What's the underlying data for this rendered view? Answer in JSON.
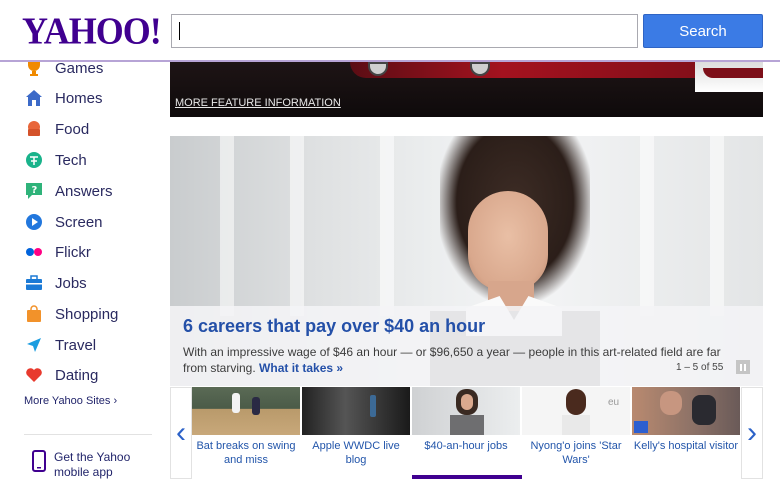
{
  "header": {
    "logo": "YAHOO!",
    "search_value": "",
    "search_button": "Search"
  },
  "sidebar": {
    "items": [
      {
        "label": "Games",
        "icon": "games-icon",
        "color": "#f08a00"
      },
      {
        "label": "Homes",
        "icon": "homes-icon",
        "color": "#3c6ac8"
      },
      {
        "label": "Food",
        "icon": "food-icon",
        "color": "#e8663a"
      },
      {
        "label": "Tech",
        "icon": "tech-icon",
        "color": "#19b38b"
      },
      {
        "label": "Answers",
        "icon": "answers-icon",
        "color": "#2fb37a"
      },
      {
        "label": "Screen",
        "icon": "screen-icon",
        "color": "#2277dd"
      },
      {
        "label": "Flickr",
        "icon": "flickr-icon",
        "color": "#ff0084"
      },
      {
        "label": "Jobs",
        "icon": "jobs-icon",
        "color": "#1b7ad6"
      },
      {
        "label": "Shopping",
        "icon": "shopping-icon",
        "color": "#f2922a"
      },
      {
        "label": "Travel",
        "icon": "travel-icon",
        "color": "#1c9de0"
      },
      {
        "label": "Dating",
        "icon": "dating-icon",
        "color": "#e83a2e"
      }
    ],
    "more": "More Yahoo Sites",
    "app": "Get the Yahoo mobile app"
  },
  "feature": {
    "link": "MORE FEATURE INFORMATION"
  },
  "hero": {
    "title": "6 careers that pay over $40 an hour",
    "desc": "With an impressive wage of $46 an hour — or $96,650 a year — people in this art-related field are far from starving.",
    "link": "What it takes »",
    "counter": "1 – 5 of 55"
  },
  "carousel": {
    "items": [
      {
        "caption": "Bat breaks on swing and miss"
      },
      {
        "caption": "Apple WWDC live blog"
      },
      {
        "caption": "$40-an-hour jobs",
        "active": true
      },
      {
        "caption": "Nyong'o joins 'Star Wars'"
      },
      {
        "caption": "Kelly's hospital visitor"
      }
    ]
  },
  "colors": {
    "brand": "#400090",
    "accent": "#3b7be5",
    "link": "#2450a8"
  }
}
